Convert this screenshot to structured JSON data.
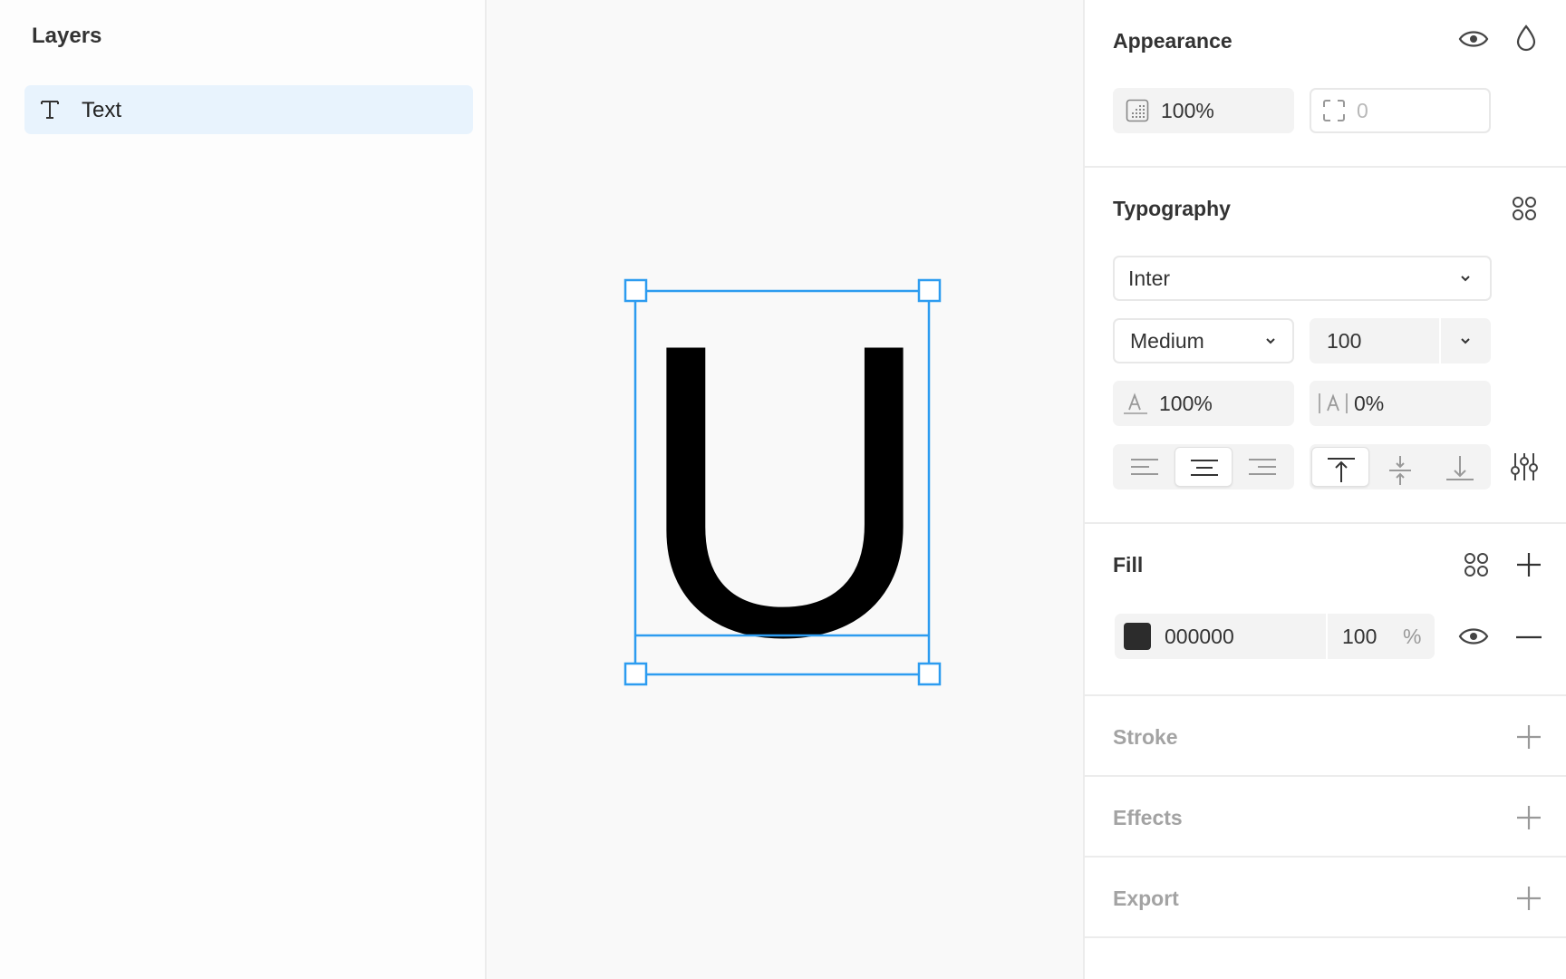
{
  "layers": {
    "title": "Layers",
    "items": [
      {
        "label": "Text",
        "icon": "text-type-icon",
        "selected": true
      }
    ]
  },
  "canvas": {
    "glyph": "U",
    "selection_color": "#2d9cf0"
  },
  "appearance": {
    "title": "Appearance",
    "opacity_value": "100%",
    "corner_radius_placeholder": "0"
  },
  "typography": {
    "title": "Typography",
    "font_family": "Inter",
    "font_weight": "Medium",
    "font_size": "100",
    "line_height": "100%",
    "letter_spacing": "0%",
    "text_align": "center",
    "vertical_align": "top"
  },
  "fill": {
    "title": "Fill",
    "hex": "000000",
    "swatch_color": "#2c2c2c",
    "opacity": "100",
    "opacity_unit": "%"
  },
  "stroke": {
    "title": "Stroke"
  },
  "effects": {
    "title": "Effects"
  },
  "export": {
    "title": "Export"
  }
}
